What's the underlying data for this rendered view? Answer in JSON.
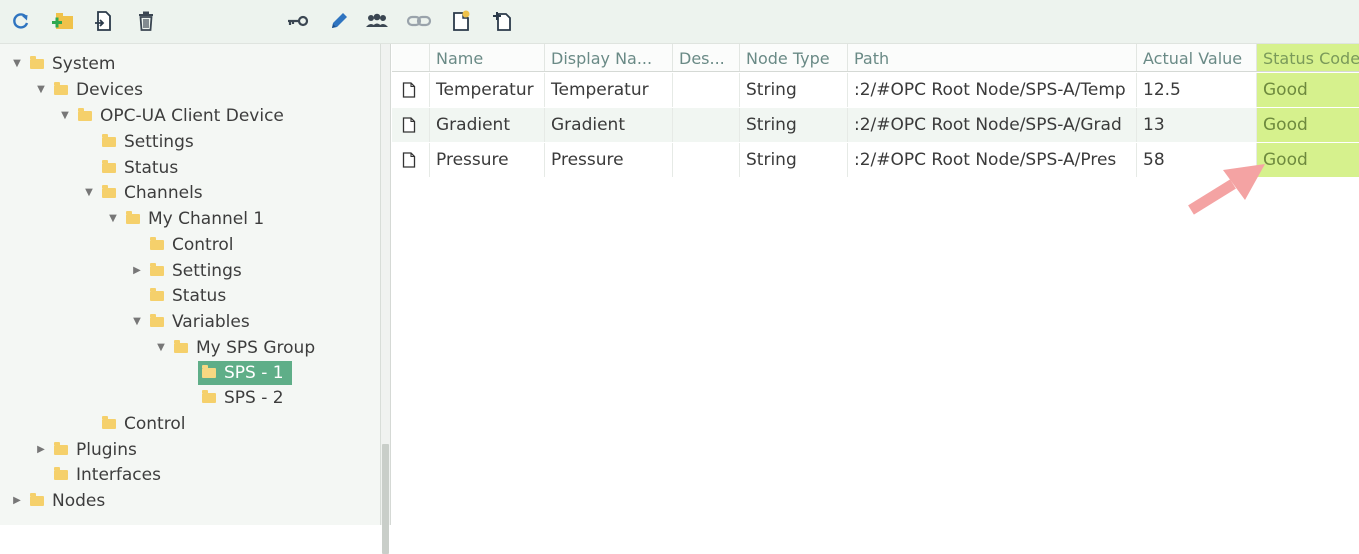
{
  "toolbar": {
    "buttons": [
      {
        "icon": "refresh-icon",
        "name": "refresh-button"
      },
      {
        "icon": "add-folder-icon",
        "name": "add-folder-button"
      },
      {
        "icon": "add-item-icon",
        "name": "add-item-button"
      },
      {
        "icon": "delete-icon",
        "name": "delete-button"
      },
      {
        "icon": "key-icon",
        "name": "key-button"
      },
      {
        "icon": "edit-icon",
        "name": "edit-button"
      },
      {
        "icon": "users-icon",
        "name": "users-button"
      },
      {
        "icon": "link-icon",
        "name": "link-button"
      },
      {
        "icon": "new-document-icon",
        "name": "new-document-button"
      },
      {
        "icon": "add-document-icon",
        "name": "add-document-button"
      }
    ]
  },
  "tree": {
    "items": [
      {
        "label": "System",
        "expanded": true
      },
      {
        "label": "Devices",
        "expanded": true
      },
      {
        "label": "OPC-UA Client Device",
        "expanded": true
      },
      {
        "label": "Settings"
      },
      {
        "label": "Status"
      },
      {
        "label": "Channels",
        "expanded": true
      },
      {
        "label": "My Channel 1",
        "expanded": true
      },
      {
        "label": "Control"
      },
      {
        "label": "Settings",
        "expanded": false
      },
      {
        "label": "Status"
      },
      {
        "label": "Variables",
        "expanded": true
      },
      {
        "label": "My SPS Group",
        "expanded": true
      },
      {
        "label": "SPS - 1",
        "selected": true
      },
      {
        "label": "SPS - 2"
      },
      {
        "label": "Control"
      },
      {
        "label": "Plugins",
        "expanded": false
      },
      {
        "label": "Interfaces"
      },
      {
        "label": "Nodes",
        "expanded": false
      }
    ]
  },
  "grid": {
    "columns": [
      "",
      "Name",
      "Display Na...",
      "Des...",
      "Node Type",
      "Path",
      "Actual Value",
      "Status Code"
    ],
    "rows": [
      {
        "name": "Temperatur",
        "display_name": "Temperatur",
        "description": "",
        "node_type": "String",
        "path": ":2/#OPC Root Node/SPS-A/Temp",
        "actual_value": "12.5",
        "status_code": "Good"
      },
      {
        "name": "Gradient",
        "display_name": "Gradient",
        "description": "",
        "node_type": "String",
        "path": ":2/#OPC Root Node/SPS-A/Grad",
        "actual_value": "13",
        "status_code": "Good"
      },
      {
        "name": "Pressure",
        "display_name": "Pressure",
        "description": "",
        "node_type": "String",
        "path": ":2/#OPC Root Node/SPS-A/Pres",
        "actual_value": "58",
        "status_code": "Good"
      }
    ]
  },
  "colors": {
    "status_highlight": "#d6f18d",
    "selection": "#5fae88",
    "folder": "#f5d06b",
    "pointer_arrow": "#f4a3a3"
  }
}
